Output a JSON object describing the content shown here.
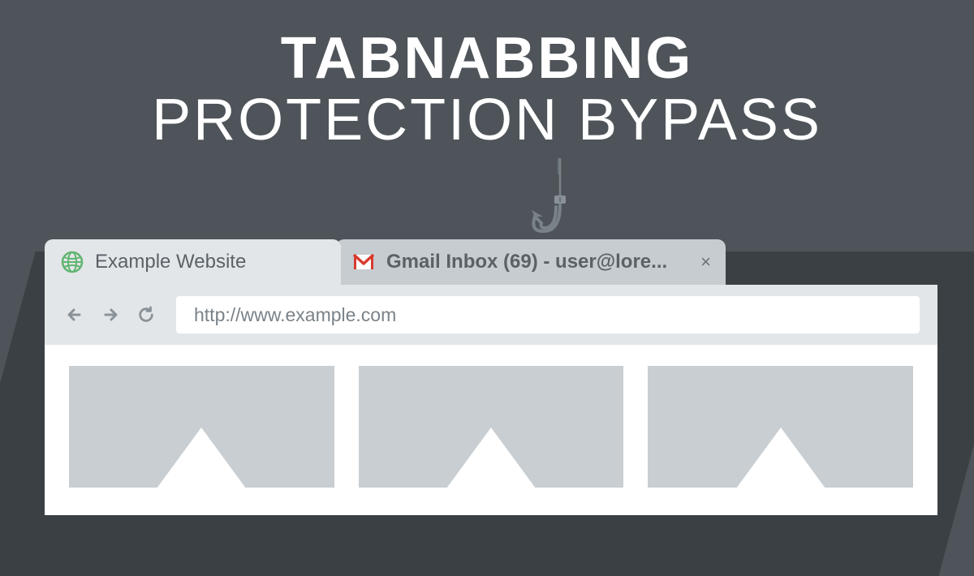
{
  "title": {
    "line1": "TABNABBING",
    "line2": "PROTECTION BYPASS"
  },
  "browser": {
    "tabs": [
      {
        "label": "Example Website",
        "icon": "globe",
        "active": true
      },
      {
        "label": "Gmail Inbox (69) - user@lore...",
        "icon": "gmail",
        "active": false,
        "closable": true
      }
    ],
    "url": "http://www.example.com"
  }
}
